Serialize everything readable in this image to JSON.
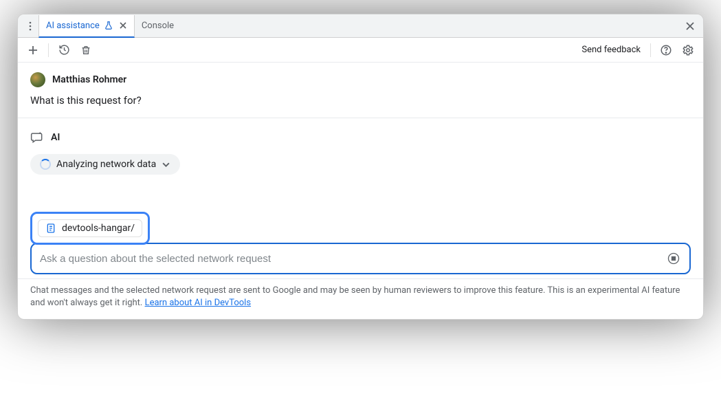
{
  "tabs": {
    "active_label": "AI assistance",
    "inactive_label": "Console"
  },
  "toolbar": {
    "feedback_label": "Send feedback"
  },
  "user": {
    "name": "Matthias Rohmer",
    "message": "What is this request for?"
  },
  "ai": {
    "label": "AI",
    "status_text": "Analyzing network data"
  },
  "context": {
    "chip_label": "devtools-hangar/"
  },
  "prompt": {
    "placeholder": "Ask a question about the selected network request"
  },
  "disclaimer": {
    "text_part1": "Chat messages and the selected network request are sent to Google and may be seen by human reviewers to improve this feature. This is an experimental AI feature and won't always get it right. ",
    "link_text": "Learn about AI in DevTools"
  }
}
